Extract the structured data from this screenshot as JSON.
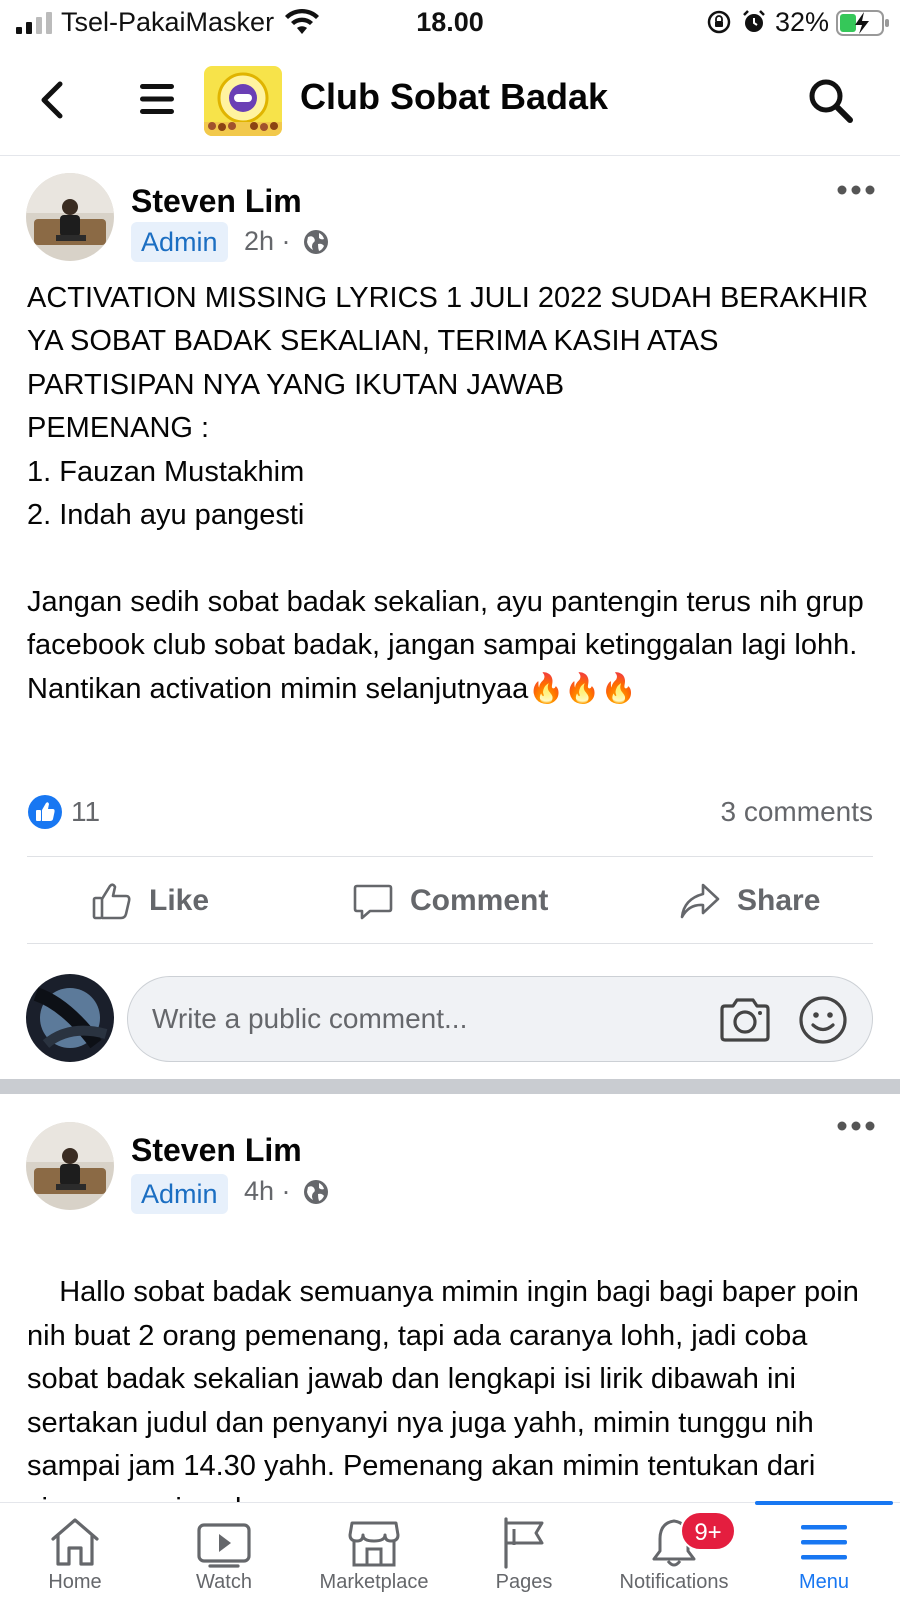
{
  "status_bar": {
    "carrier": "Tsel-PakaiMasker",
    "time": "18.00",
    "battery": "32%"
  },
  "header": {
    "title": "Club Sobat Badak"
  },
  "posts": [
    {
      "author": "Steven Lim",
      "role": "Admin",
      "time": "2h ·",
      "text": "ACTIVATION MISSING LYRICS 1 JULI 2022 SUDAH BERAKHIR YA SOBAT BADAK SEKALIAN, TERIMA KASIH ATAS PARTISIPAN NYA YANG IKUTAN JAWAB\nPEMENANG :\n1. Fauzan Mustakhim\n2. Indah ayu pangesti\n\nJangan sedih sobat badak sekalian, ayu pantengin terus nih grup facebook club sobat badak, jangan sampai ketinggalan lagi lohh. Nantikan activation mimin selanjutnyaa",
      "emoji": "🔥🔥🔥",
      "likes": "11",
      "comments": "3 comments",
      "actions": {
        "like": "Like",
        "comment": "Comment",
        "share": "Share"
      },
      "comment_placeholder": "Write a public comment..."
    },
    {
      "author": "Steven Lim",
      "role": "Admin",
      "time": "4h ·",
      "text": "Hallo sobat badak semuanya mimin ingin bagi bagi baper poin nih buat 2 orang pemenang, tapi ada caranya lohh, jadi coba sobat badak sekalian jawab dan lengkapi isi lirik dibawah ini sertakan judul dan penyanyi nya juga yahh, mimin tunggu nih sampai jam 14.30 yahh. Pemenang akan mimin tentukan dari siapa yang jawab"
    }
  ],
  "bottom_nav": {
    "items": [
      {
        "label": "Home",
        "icon": "home-icon"
      },
      {
        "label": "Watch",
        "icon": "watch-icon"
      },
      {
        "label": "Marketplace",
        "icon": "marketplace-icon"
      },
      {
        "label": "Pages",
        "icon": "pages-flag-icon"
      },
      {
        "label": "Notifications",
        "icon": "bell-icon",
        "badge": "9+"
      },
      {
        "label": "Menu",
        "icon": "menu-icon",
        "active": true
      }
    ]
  },
  "colors": {
    "accent": "#1877f2",
    "badge_red": "#e41e3f",
    "admin_badge_bg": "#e7f0fb",
    "secondary_text": "#65676b"
  }
}
